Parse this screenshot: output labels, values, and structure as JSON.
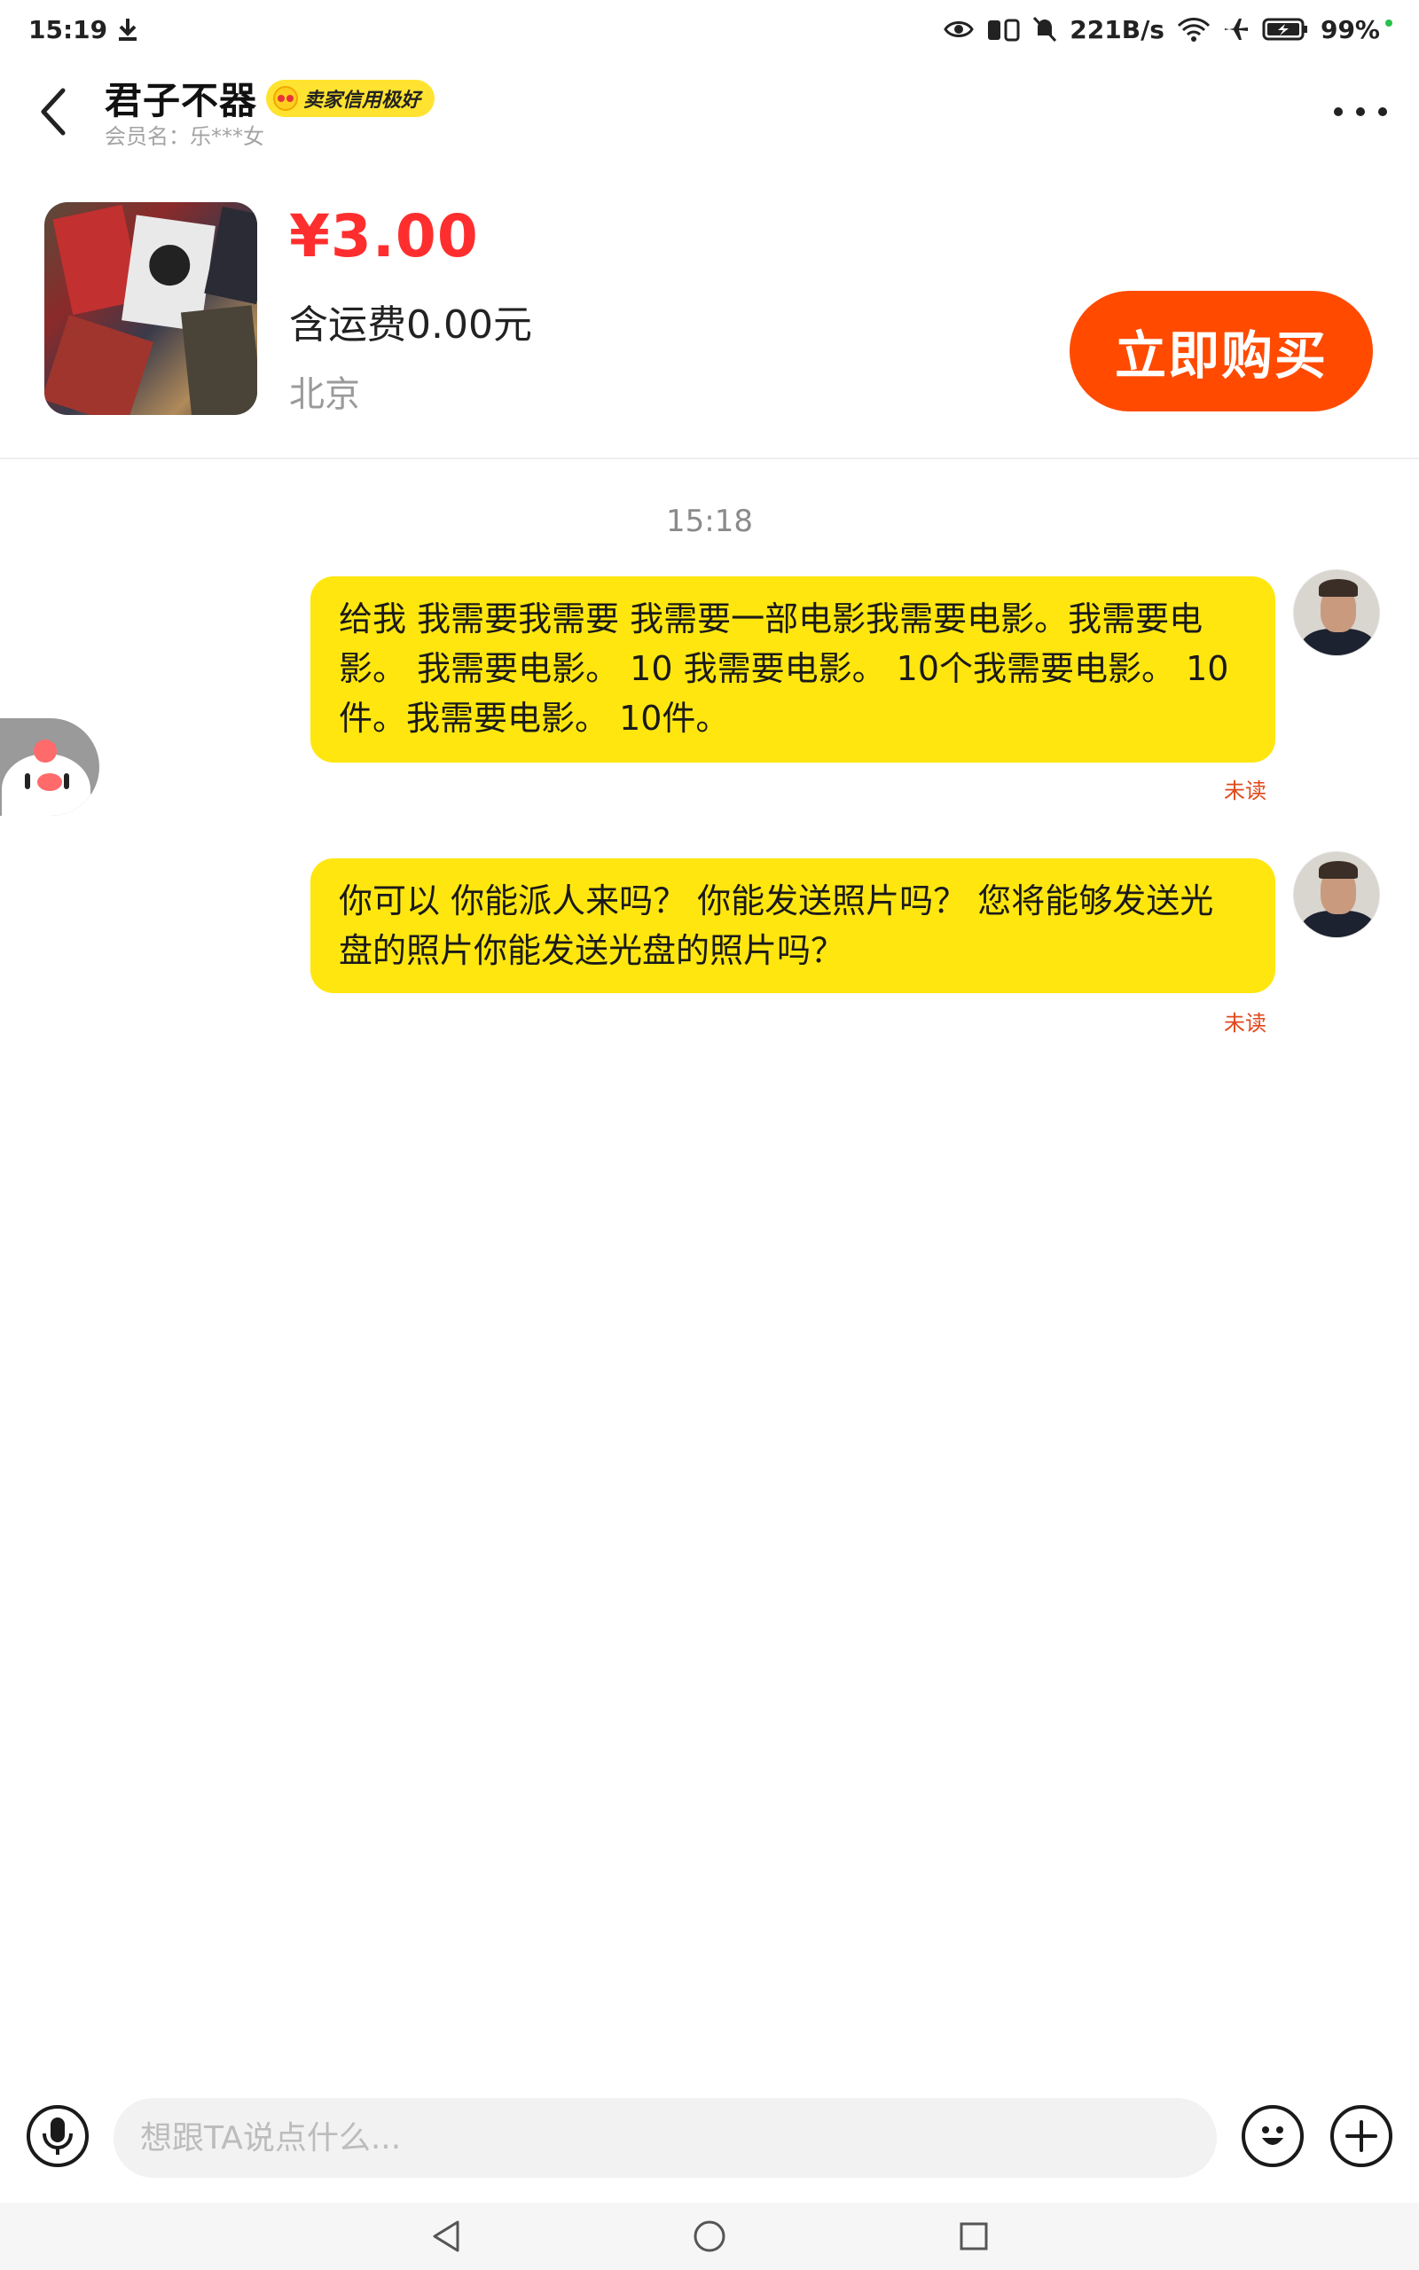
{
  "status_bar": {
    "time": "15:19",
    "network_speed": "221B/s",
    "battery": "99%"
  },
  "header": {
    "seller_name": "君子不器",
    "credit_badge": "卖家信用极好",
    "member_name": "会员名：乐***女"
  },
  "product": {
    "price": "¥3.00",
    "shipping": "含运费0.00元",
    "location": "北京",
    "buy_label": "立即购买"
  },
  "chat": {
    "time": "15:18",
    "messages": [
      {
        "text": "给我 我需要我需要 我需要一部电影我需要电影。我需要电影。 我需要电影。 10 我需要电影。 10个我需要电影。 10件。我需要电影。 10件。",
        "status": "未读"
      },
      {
        "text": "你可以 你能派人来吗？ 你能发送照片吗？ 您将能够发送光盘的照片你能发送光盘的照片吗？",
        "status": "未读"
      }
    ]
  },
  "input": {
    "placeholder": "想跟TA说点什么..."
  },
  "icons": {
    "back": "chevron-left-icon",
    "more": "more-dots-icon",
    "mic": "microphone-icon",
    "emoji": "emoji-icon",
    "plus": "plus-icon"
  },
  "colors": {
    "bubble": "#ffe60f",
    "buy_button": "#ff4a00",
    "price": "#ff2e2e",
    "badge": "#ffe330",
    "unread": "#e0471a"
  }
}
